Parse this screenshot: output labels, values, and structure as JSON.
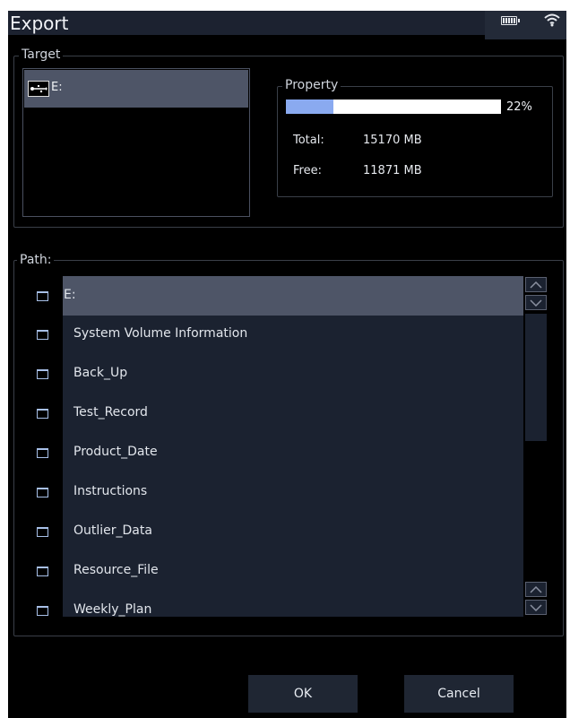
{
  "window": {
    "title": "Export"
  },
  "status": {
    "battery_icon": "battery-icon",
    "wifi_icon": "wifi-icon"
  },
  "target": {
    "legend": "Target",
    "items": [
      {
        "label": "E:",
        "icon": "usb-drive-icon"
      }
    ]
  },
  "property": {
    "legend": "Property",
    "usage_percent": 22,
    "usage_label": "22%",
    "total_label": "Total:",
    "total_value": "15170 MB",
    "free_label": "Free:",
    "free_value": "11871 MB"
  },
  "path": {
    "legend": "Path:",
    "root": "E:",
    "folders": [
      "System Volume Information",
      "Back_Up",
      "Test_Record",
      "Product_Date",
      "Instructions",
      "Outlier_Data",
      "Resource_File",
      "Weekly_Plan"
    ]
  },
  "buttons": {
    "ok": "OK",
    "cancel": "Cancel"
  },
  "colors": {
    "selection": "#4e5567",
    "progress_fill": "#8aaaf0",
    "list_bg": "#1b2230"
  }
}
